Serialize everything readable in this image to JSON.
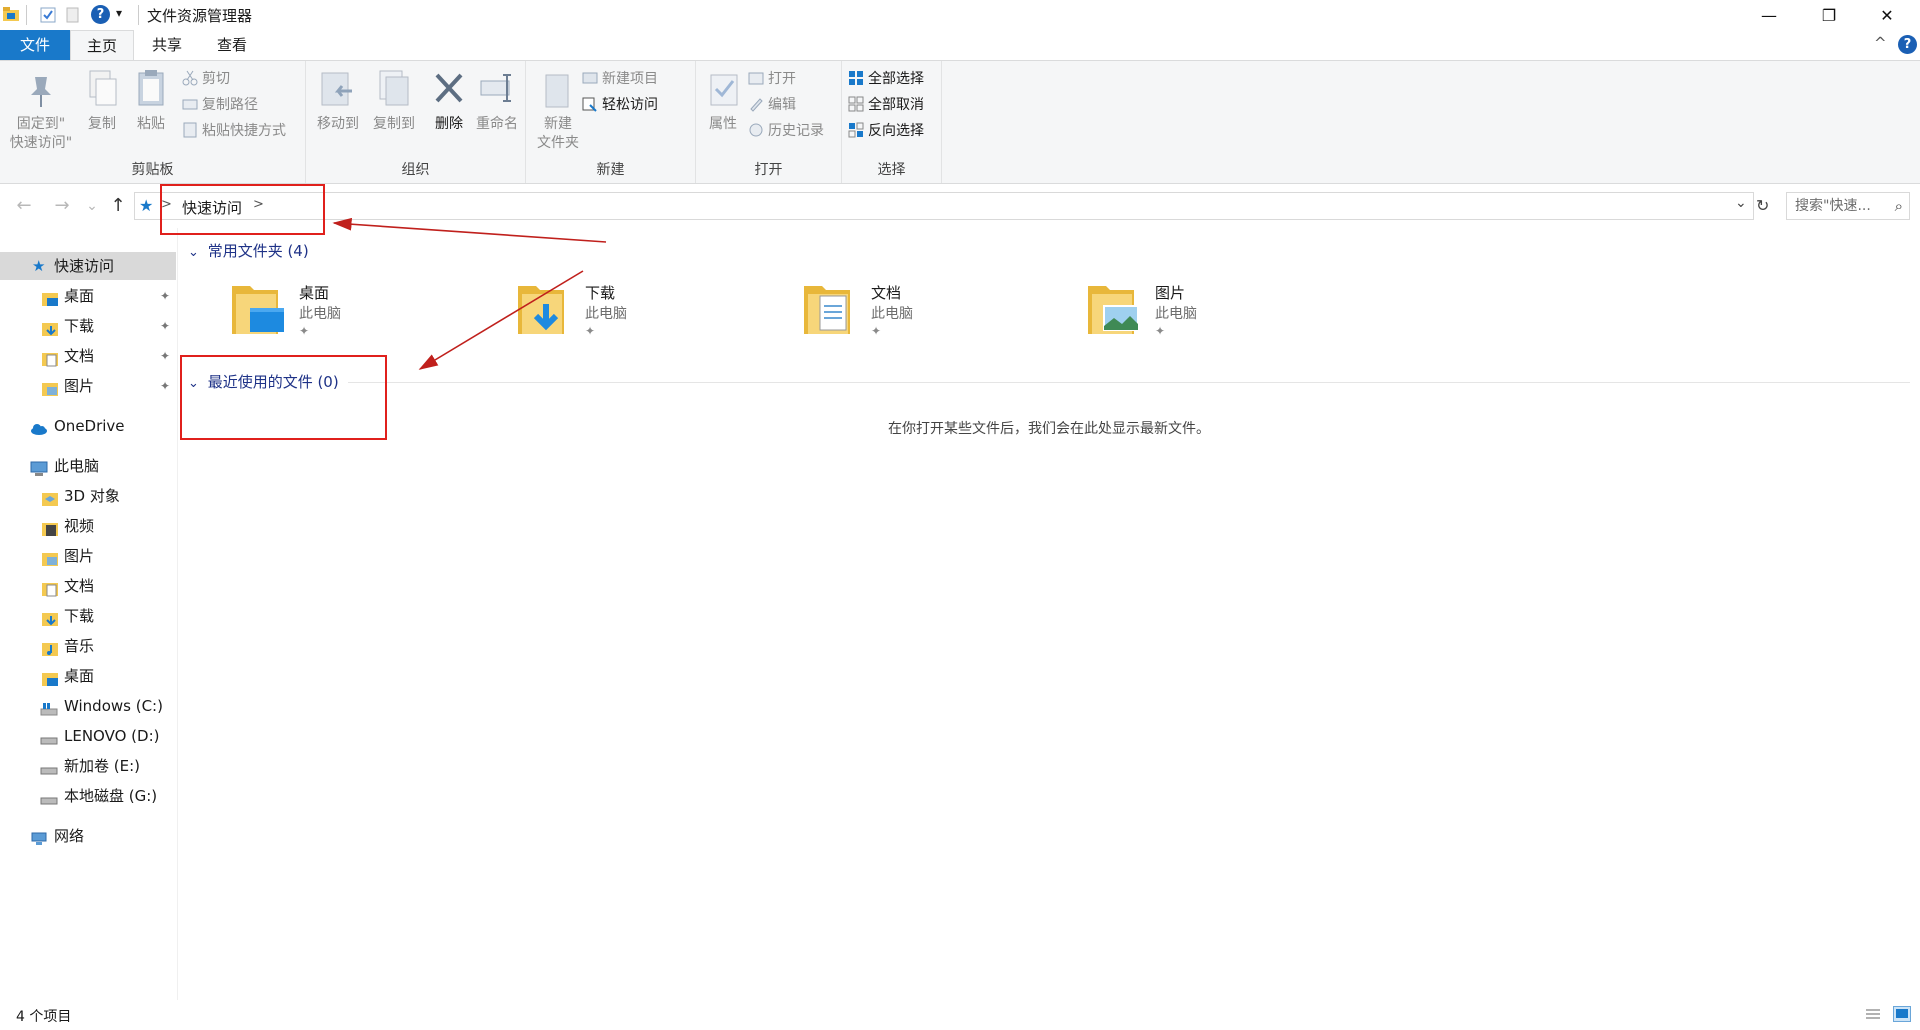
{
  "window": {
    "title": "文件资源管理器",
    "minimize_glyph": "—",
    "restore_glyph": "❐",
    "close_glyph": "✕",
    "qat_help": "?",
    "qat_dropdown": "▾"
  },
  "ribbon_tabs": [
    {
      "label": "文件"
    },
    {
      "label": "主页"
    },
    {
      "label": "共享"
    },
    {
      "label": "查看"
    }
  ],
  "ribbon_controls": {
    "collapse_glyph": "^",
    "help": "?"
  },
  "ribbon": {
    "clipboard": {
      "label": "剪贴板",
      "pin_line1": "固定到\"",
      "pin_line2": "快速访问\"",
      "copy": "复制",
      "paste": "粘贴",
      "cut": "剪切",
      "copy_path": "复制路径",
      "paste_shortcut": "粘贴快捷方式"
    },
    "organize": {
      "label": "组织",
      "move_to": "移动到",
      "copy_to": "复制到",
      "delete": "删除",
      "rename": "重命名"
    },
    "new": {
      "label": "新建",
      "new_folder_line1": "新建",
      "new_folder_line2": "文件夹",
      "new_item": "新建项目",
      "easy_access": "轻松访问"
    },
    "open": {
      "label": "打开",
      "properties": "属性",
      "open": "打开",
      "edit": "编辑",
      "history": "历史记录"
    },
    "select": {
      "label": "选择",
      "select_all": "全部选择",
      "select_none": "全部取消",
      "invert": "反向选择"
    }
  },
  "address": {
    "back": "←",
    "forward": "→",
    "recent": "⌄",
    "up": "↑",
    "chevron": ">",
    "crumb": "快速访问",
    "crumb_chevron": ">",
    "dropdown": "⌄",
    "refresh": "↻",
    "search_placeholder": "搜索\"快速...",
    "search_icon": "⌕"
  },
  "sidebar": {
    "quick_access": "快速访问",
    "pinned": [
      {
        "label": "桌面"
      },
      {
        "label": "下载"
      },
      {
        "label": "文档"
      },
      {
        "label": "图片"
      }
    ],
    "pin_glyph": "📌",
    "onedrive": "OneDrive",
    "this_pc": "此电脑",
    "pc_items": [
      {
        "label": "3D 对象"
      },
      {
        "label": "视频"
      },
      {
        "label": "图片"
      },
      {
        "label": "文档"
      },
      {
        "label": "下载"
      },
      {
        "label": "音乐"
      },
      {
        "label": "桌面"
      },
      {
        "label": "Windows (C:)"
      },
      {
        "label": "LENOVO (D:)"
      },
      {
        "label": "新加卷 (E:)"
      },
      {
        "label": "本地磁盘 (G:)"
      }
    ],
    "network": "网络"
  },
  "main": {
    "frequent_header": "常用文件夹 (4)",
    "frequent": [
      {
        "name": "桌面",
        "location": "此电脑"
      },
      {
        "name": "下载",
        "location": "此电脑"
      },
      {
        "name": "文档",
        "location": "此电脑"
      },
      {
        "name": "图片",
        "location": "此电脑"
      }
    ],
    "recent_header": "最近使用的文件 (0)",
    "recent_empty": "在你打开某些文件后，我们会在此处显示最新文件。",
    "section_chevron": "⌄"
  },
  "status": {
    "count": "4 个项目"
  },
  "colors": {
    "accent": "#1979ca",
    "folder": "#f4c951",
    "annotation": "#e0201c",
    "section_header": "#1e3287"
  }
}
